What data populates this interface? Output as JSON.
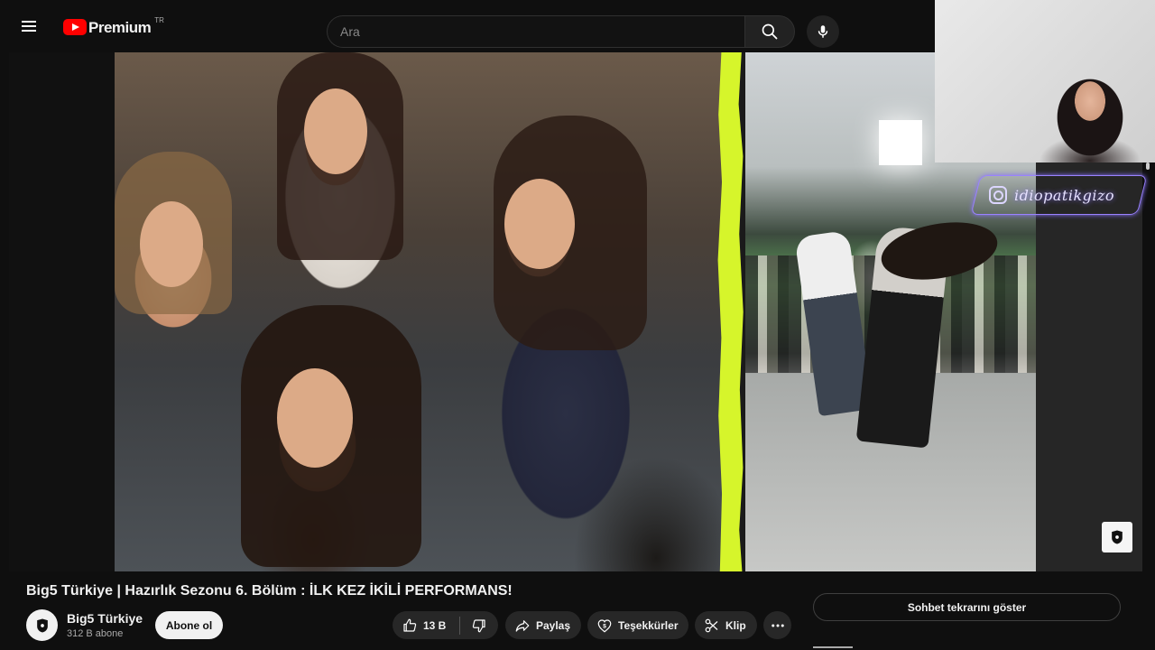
{
  "header": {
    "brand": "Premium",
    "region": "TR",
    "search_placeholder": "Ara"
  },
  "video": {
    "overlay_handle": "idiopatikgizo"
  },
  "info": {
    "title": "Big5 Türkiye | Hazırlık Sezonu 6. Bölüm : İLK KEZ İKİLİ PERFORMANS!",
    "channel_name": "Big5 Türkiye",
    "subscribers": "312 B abone",
    "subscribe_label": "Abone ol"
  },
  "actions": {
    "likes": "13 B",
    "share_label": "Paylaş",
    "thanks_label": "Teşekkürler",
    "clip_label": "Klip"
  },
  "chat": {
    "replay_label": "Sohbet tekrarını göster"
  },
  "colors": {
    "accent_red": "#ff0000",
    "strip_lime": "#d6f52b",
    "neon_purple": "#9a82ff"
  }
}
